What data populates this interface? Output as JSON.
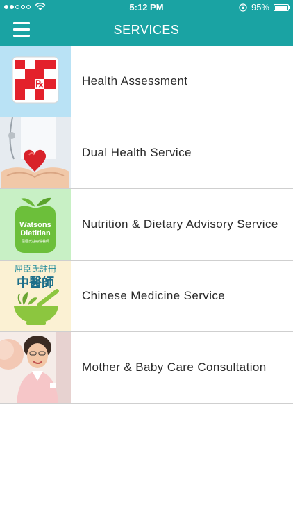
{
  "status_bar": {
    "time": "5:12 PM",
    "battery": "95%",
    "battery_level": 0.95,
    "signal_bars_filled": 2,
    "signal_bars_total": 5
  },
  "nav": {
    "title": "SERVICES",
    "menu_icon": "hamburger-menu-icon"
  },
  "services": [
    {
      "label": "Health Assessment",
      "thumb_text": "℞"
    },
    {
      "label": "Dual Health Service"
    },
    {
      "label": "Nutrition & Dietary Advisory Service",
      "thumb_text": [
        "Watsons",
        "Dietitian",
        "屈臣氏註冊營養師"
      ]
    },
    {
      "label": "Chinese Medicine Service",
      "thumb_text": [
        "屈臣氏註冊",
        "中醫師"
      ]
    },
    {
      "label": "Mother & Baby Care Consultation"
    }
  ]
}
